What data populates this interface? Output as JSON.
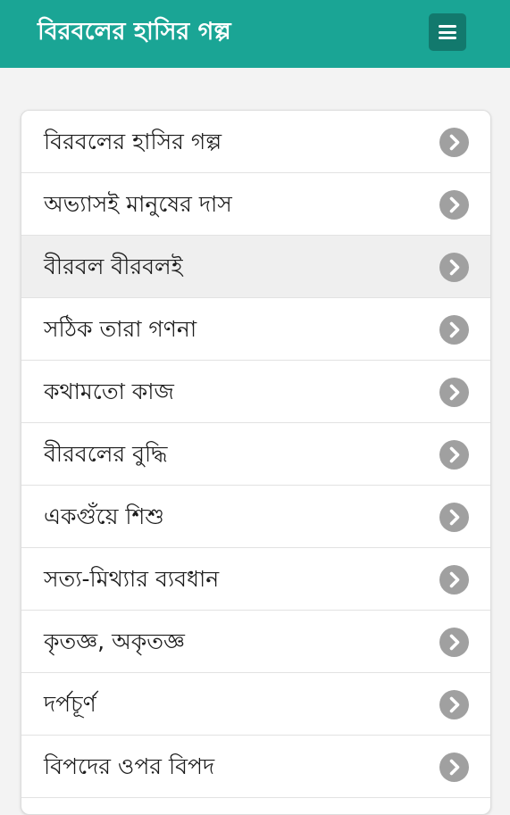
{
  "header": {
    "title": "বিরবলের হাসির গল্প",
    "menu_icon": "hamburger-menu-icon",
    "background_color": "#1aa595",
    "menu_button_color": "#12796d"
  },
  "list": {
    "items": [
      {
        "label": "বিরবলের হাসির গল্প",
        "icon": "chevron-right-circle-icon"
      },
      {
        "label": "অভ্যাসই মানুষের দাস",
        "icon": "chevron-right-circle-icon"
      },
      {
        "label": "বীরবল বীরবলই",
        "icon": "chevron-right-circle-icon",
        "highlighted": true
      },
      {
        "label": "সঠিক তারা গণনা",
        "icon": "chevron-right-circle-icon"
      },
      {
        "label": "কথামতো কাজ",
        "icon": "chevron-right-circle-icon"
      },
      {
        "label": "বীরবলের বুদ্ধি",
        "icon": "chevron-right-circle-icon"
      },
      {
        "label": "একগুঁয়ে শিশু",
        "icon": "chevron-right-circle-icon"
      },
      {
        "label": "সত্য-মিথ্যার ব্যবধান",
        "icon": "chevron-right-circle-icon"
      },
      {
        "label": "কৃতজ্ঞ, অকৃতজ্ঞ",
        "icon": "chevron-right-circle-icon"
      },
      {
        "label": "দর্পচূর্ণ",
        "icon": "chevron-right-circle-icon"
      },
      {
        "label": "বিপদের ওপর বিপদ",
        "icon": "chevron-right-circle-icon"
      }
    ]
  }
}
